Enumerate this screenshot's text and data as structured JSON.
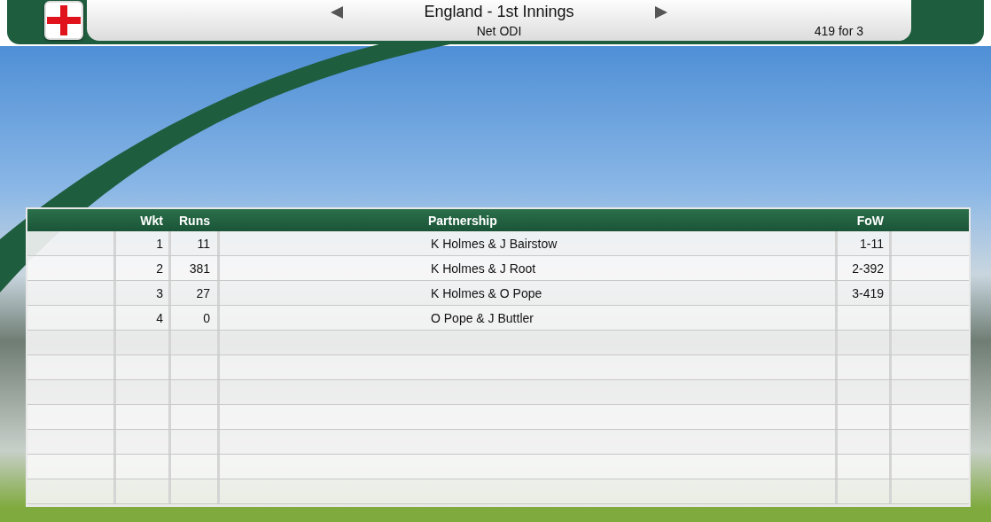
{
  "header": {
    "title": "England - 1st Innings",
    "subtitle": "Net ODI",
    "score": "419 for 3"
  },
  "table": {
    "columns": [
      "Wkt",
      "Runs",
      "Partnership",
      "FoW"
    ],
    "rows": [
      [
        "1",
        "11",
        "K Holmes & J Bairstow",
        "1-11"
      ],
      [
        "2",
        "381",
        "K Holmes & J Root",
        "2-392"
      ],
      [
        "3",
        "27",
        "K Holmes & O Pope",
        "3-419"
      ],
      [
        "4",
        "0",
        "O Pope & J Buttler",
        ""
      ]
    ]
  }
}
